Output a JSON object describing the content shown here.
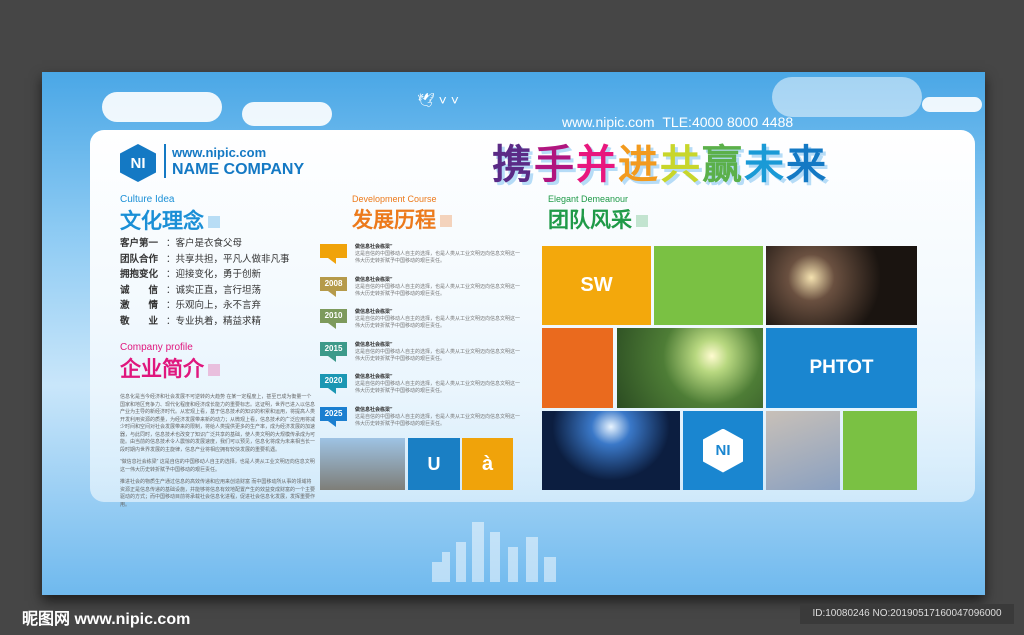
{
  "header": {
    "url": "www.nipic.com",
    "tel": "TLE:4000 8000 4488",
    "slogan": [
      {
        "t": "携",
        "c": "#5b2a86"
      },
      {
        "t": "手",
        "c": "#b0157f"
      },
      {
        "t": "并",
        "c": "#e8177e"
      },
      {
        "t": "进",
        "c": "#f29a1e"
      },
      {
        "t": " ",
        "c": "#fff"
      },
      {
        "t": "共",
        "c": "#c8d62b"
      },
      {
        "t": "赢",
        "c": "#5bb04a"
      },
      {
        "t": "未",
        "c": "#1a9ad6"
      },
      {
        "t": "来",
        "c": "#1479c4"
      }
    ]
  },
  "brand": {
    "logo": "NI",
    "url": "www.nipic.com",
    "name": "NAME COMPANY"
  },
  "culture": {
    "en": "Culture Idea",
    "title": "文化理念",
    "items": [
      {
        "k": "客户第一",
        "v": "：客户是衣食父母"
      },
      {
        "k": "团队合作",
        "v": "：共享共担，平凡人做非凡事"
      },
      {
        "k": "拥抱变化",
        "v": "：迎接变化，勇于创新"
      },
      {
        "k": "诚　　信",
        "v": "：诚实正直，言行坦荡"
      },
      {
        "k": "激　　情",
        "v": "：乐观向上，永不言弃"
      },
      {
        "k": "敬　　业",
        "v": "：专业执着，精益求精"
      }
    ]
  },
  "profile": {
    "en": "Company profile",
    "title": "企业简介",
    "paragraphs": [
      "信息化是当今经济和社会发展不可逆转的大趋势 在某一定程度上，甚至已成为衡量一个国家和地区竞争力、现代化程度和经济成长能力的重要标志。这证明，世界已进入以信息产业为主导的新经济时代。从宏观上看，基于信息技术的知识的积累和运用，将提高人类开发利用资源的质量，为经济发展带来新的动力；从微观上看，信息技术的广泛应用将减少时间和空间对社会发展带来的限制，将给人类提供更多的生产率，成为经济发展的加速器，与此同时，信息技术也改变了知识广泛共享的基础，使人类文明的大规模传承成为可能。由当前的信息技术令人震惊的发展速度，我们可以预见，信息化将成为未来相当长一段时期内世界发展的主旋律，信息产业将相应拥有较快发展的重要机遇。",
      "“做信息社会栋梁” 这是自信的中国移动人自主的选择，也是人类从工业文明迈向信息文明这一伟大历史转折赋予中国移动的艰巨责任。",
      "推进社会的物质生产通过信息的高效传递和应用来创造财富 而中国移动所从事的领域将资源正是信息传递的基础设施，并能够将信息有效地配置产生的效益变成财富的一个主要驱动的方式；而中国移动目前将承载社会信息化进程，促进社会信息化发展，发挥重要作用。"
    ]
  },
  "development": {
    "en": "Development Course",
    "title": "发展历程",
    "items": [
      {
        "year": "",
        "color": "#f0a30a",
        "head": "做信息社会栋梁”",
        "body": "这是自信的中国移动人自主的选择，也是人类从工业文明迈向信息文明这一伟大历史转折赋予中国移动的艰巨责任。"
      },
      {
        "year": "2008",
        "color": "#b59a4a",
        "head": "做信息社会栋梁”",
        "body": "这是自信的中国移动人自主的选择，也是人类从工业文明迈向信息文明这一伟大历史转折赋予中国移动的艰巨责任。"
      },
      {
        "year": "2010",
        "color": "#7d9a5c",
        "head": "做信息社会栋梁”",
        "body": "这是自信的中国移动人自主的选择，也是人类从工业文明迈向信息文明这一伟大历史转折赋予中国移动的艰巨责任。"
      },
      {
        "year": "2015",
        "color": "#3d9a8a",
        "head": "做信息社会栋梁”",
        "body": "这是自信的中国移动人自主的选择，也是人类从工业文明迈向信息文明这一伟大历史转折赋予中国移动的艰巨责任。"
      },
      {
        "year": "2020",
        "color": "#1b97b3",
        "head": "做信息社会栋梁”",
        "body": "这是自信的中国移动人自主的选择，也是人类从工业文明迈向信息文明这一伟大历史转折赋予中国移动的艰巨责任。"
      },
      {
        "year": "2025",
        "color": "#1b7fd0",
        "head": "做信息社会栋梁”",
        "body": "这是自信的中国移动人自主的选择，也是人类从工业文明迈向信息文明这一伟大历史转折赋予中国移动的艰巨责任。"
      }
    ],
    "tiles": {
      "u": "U",
      "a": "à"
    }
  },
  "team": {
    "en": "Elegant Demeanour",
    "title": "团队风采",
    "sw": "SW",
    "phtot": "PHTOT",
    "logo": "NI"
  },
  "watermark": {
    "left": "昵图网 www.nipic.com",
    "right": "ID:10080246 NO:20190517160047096000"
  }
}
